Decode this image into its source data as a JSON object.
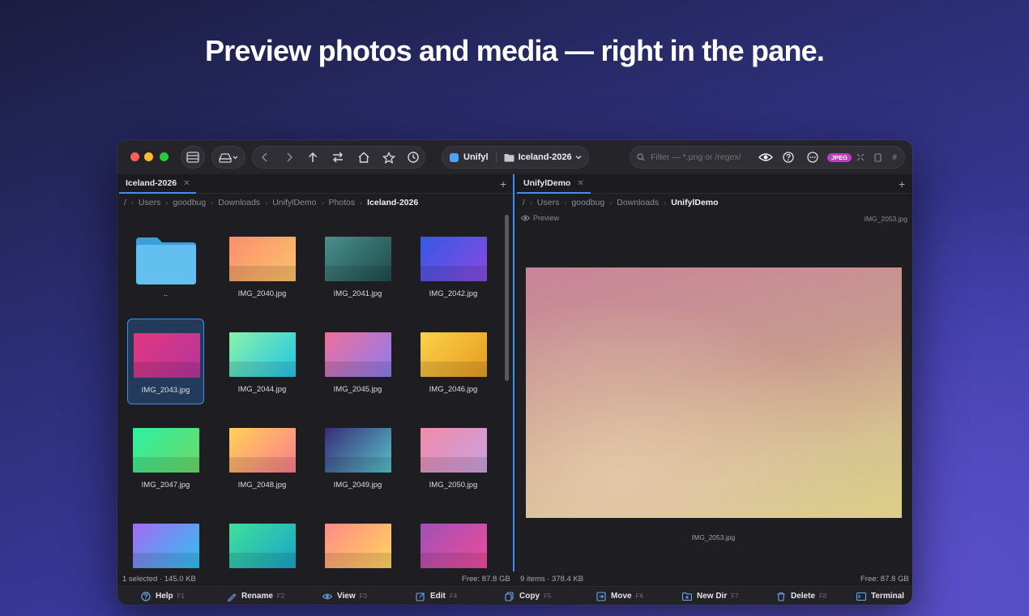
{
  "headline": "Preview photos and media — right in the pane.",
  "toolbar": {
    "app_name": "Unifyl",
    "folder": "Iceland-2026",
    "filter_placeholder": "Filter — *.png or /regex/",
    "badge": "JPEG",
    "hash": "#"
  },
  "left_pane": {
    "tab": "Iceland-2026",
    "breadcrumb": [
      "/",
      "Users",
      "goodbug",
      "Downloads",
      "UnifylDemo",
      "Photos",
      "Iceland-2026"
    ],
    "items": [
      {
        "name": "..",
        "kind": "folder"
      },
      {
        "name": "IMG_2040.jpg",
        "colors": [
          "#fa8e6e",
          "#fcc46a"
        ]
      },
      {
        "name": "IMG_2041.jpg",
        "colors": [
          "#4a8f8a",
          "#1e4b4c"
        ]
      },
      {
        "name": "IMG_2042.jpg",
        "colors": [
          "#3658e6",
          "#8a4ae0"
        ]
      },
      {
        "name": "IMG_2043.jpg",
        "colors": [
          "#e4367e",
          "#b2369d"
        ]
      },
      {
        "name": "IMG_2044.jpg",
        "colors": [
          "#8af2a8",
          "#22c4ea"
        ]
      },
      {
        "name": "IMG_2045.jpg",
        "colors": [
          "#f06f9a",
          "#8a7cf0"
        ]
      },
      {
        "name": "IMG_2046.jpg",
        "colors": [
          "#fcd24a",
          "#e69a20"
        ]
      },
      {
        "name": "IMG_2047.jpg",
        "colors": [
          "#2ef0a2",
          "#6ed866"
        ]
      },
      {
        "name": "IMG_2048.jpg",
        "colors": [
          "#ffd256",
          "#fa7c8e"
        ]
      },
      {
        "name": "IMG_2049.jpg",
        "colors": [
          "#3a2c7a",
          "#56c2c8"
        ]
      },
      {
        "name": "IMG_2050.jpg",
        "colors": [
          "#f28aa8",
          "#c8a2e0"
        ]
      },
      {
        "name": "",
        "colors": [
          "#a46af4",
          "#2ec2ee"
        ]
      },
      {
        "name": "",
        "colors": [
          "#3ee09a",
          "#1aa4c8"
        ]
      },
      {
        "name": "",
        "colors": [
          "#ff8c86",
          "#ffd45e"
        ]
      },
      {
        "name": "",
        "colors": [
          "#a050b8",
          "#ee4c9a"
        ]
      }
    ],
    "selected": "IMG_2043.jpg",
    "status_left": "1 selected · 145.0 KB",
    "status_right": "Free: 87.8 GB"
  },
  "right_pane": {
    "tab": "UnifylDemo",
    "breadcrumb": [
      "/",
      "Users",
      "goodbug",
      "Downloads",
      "UnifylDemo"
    ],
    "preview_label": "Preview",
    "preview_file": "IMG_2053.jpg",
    "caption": "IMG_2053.jpg",
    "status_left": "9 items · 378.4 KB",
    "status_right": "Free: 87.8 GB"
  },
  "function_keys": [
    {
      "label": "Help",
      "key": "F1",
      "icon": "help-icon"
    },
    {
      "label": "Rename",
      "key": "F2",
      "icon": "pencil-icon"
    },
    {
      "label": "View",
      "key": "F3",
      "icon": "eye-icon"
    },
    {
      "label": "Edit",
      "key": "F4",
      "icon": "edit-icon"
    },
    {
      "label": "Copy",
      "key": "F5",
      "icon": "copy-icon"
    },
    {
      "label": "Move",
      "key": "F6",
      "icon": "move-icon"
    },
    {
      "label": "New Dir",
      "key": "F7",
      "icon": "new-folder-icon"
    },
    {
      "label": "Delete",
      "key": "F8",
      "icon": "trash-icon"
    },
    {
      "label": "Terminal",
      "key": "",
      "icon": "terminal-icon"
    }
  ],
  "colors": {
    "accent": "#3b8ff0",
    "badge": "#c03cc4"
  }
}
